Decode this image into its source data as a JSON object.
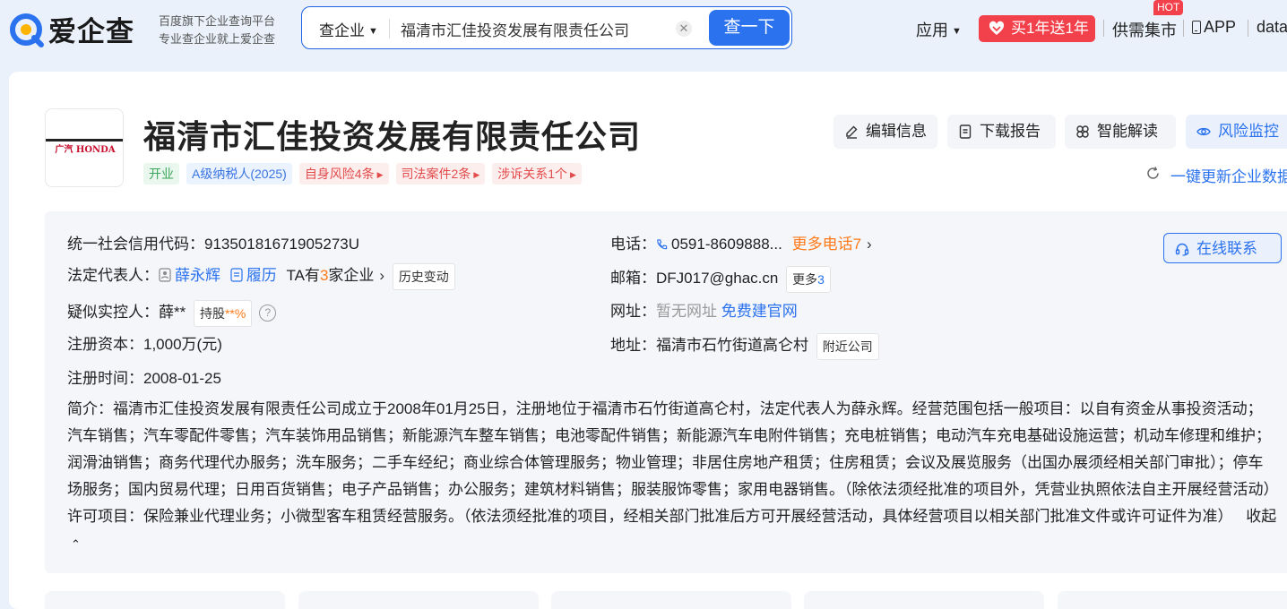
{
  "header": {
    "logo_text": "爱企查",
    "slogan_line1": "百度旗下企业查询平台",
    "slogan_line2": "专业查企业就上爱企查",
    "search": {
      "type_label": "查企业",
      "value": "福清市汇佳投资发展有限责任公司",
      "button_label": "查一下"
    },
    "nav": {
      "apps_label": "应用",
      "promo_label": "买1年送1年",
      "supply_label": "供需集市",
      "hot_badge": "HOT",
      "app_label": "APP",
      "data_label": "data"
    }
  },
  "company": {
    "logo_brand": "广汽 HONDA",
    "name": "福清市汇佳投资发展有限责任公司",
    "tags": {
      "status": "开业",
      "tax": "A级纳税人(2025)",
      "self_risk": "自身风险4条",
      "judicial": "司法案件2条",
      "litigation": "涉诉关系1个"
    },
    "actions": {
      "edit": "编辑信息",
      "download": "下载报告",
      "ai": "智能解读",
      "monitor": "风险监控",
      "refresh": "一键更新企业数据"
    }
  },
  "info": {
    "credit_code_label": "统一社会信用代码：",
    "credit_code": "91350181671905273U",
    "legal_rep_label": "法定代表人：",
    "legal_rep": "薛永辉",
    "resume": "履历",
    "ta_prefix": "TA有",
    "ta_count": "3",
    "ta_suffix": "家企业",
    "history_change": "历史变动",
    "controller_label": "疑似实控人：",
    "controller": "薛**",
    "shareholding_label": "持股",
    "shareholding_value": "**%",
    "capital_label": "注册资本：",
    "capital": "1,000万(元)",
    "reg_date_label": "注册时间：",
    "reg_date": "2008-01-25",
    "phone_label": "电话：",
    "phone": "0591-8609888...",
    "more_phone_label": "更多电话",
    "more_phone_count": "7",
    "email_label": "邮箱：",
    "email": "DFJ017@ghac.cn",
    "more_email_label": "更多",
    "more_email_count": "3",
    "website_label": "网址：",
    "website": "暂无网址",
    "build_site": "免费建官网",
    "address_label": "地址：",
    "address": "福清市石竹街道高仑村",
    "nearby": "附近公司",
    "online_contact": "在线联系",
    "intro_label": "简介：",
    "intro_text": "福清市汇佳投资发展有限责任公司成立于2008年01月25日，注册地位于福清市石竹街道高仑村，法定代表人为薛永辉。经营范围包括一般项目：以自有资金从事投资活动；汽车销售；汽车零配件零售；汽车装饰用品销售；新能源汽车整车销售；电池零配件销售；新能源汽车电附件销售；充电桩销售；电动汽车充电基础设施运营；机动车修理和维护；润滑油销售；商务代理代办服务；洗车服务；二手车经纪；商业综合体管理服务；物业管理；非居住房地产租赁；住房租赁；会议及展览服务（出国办展须经相关部门审批）；停车场服务；国内贸易代理；日用百货销售；电子产品销售；办公服务；建筑材料销售；服装服饰零售；家用电器销售。（除依法须经批准的项目外，凭营业执照依法自主开展经营活动）许可项目：保险兼业代理业务；小微型客车租赁经营服务。（依法须经批准的项目，经相关部门批准后方可开展经营活动，具体经营项目以相关部门批准文件或许可证件为准）",
    "collapse": "收起"
  },
  "colors": {
    "primary": "#2b72ee",
    "promo": "#f2414b",
    "risk_text": "#e24b4b",
    "open_text": "#3aa55b",
    "orange": "#ff7a1a"
  },
  "icons": [
    "search-logo-icon",
    "caret-down-icon",
    "clear-icon",
    "heart-icon",
    "phone-app-icon",
    "edit-icon",
    "document-icon",
    "ai-icon",
    "eye-icon",
    "refresh-icon",
    "person-icon",
    "resume-icon",
    "chevron-right-icon",
    "help-icon",
    "phone-icon",
    "headset-icon",
    "chevron-up-icon"
  ]
}
